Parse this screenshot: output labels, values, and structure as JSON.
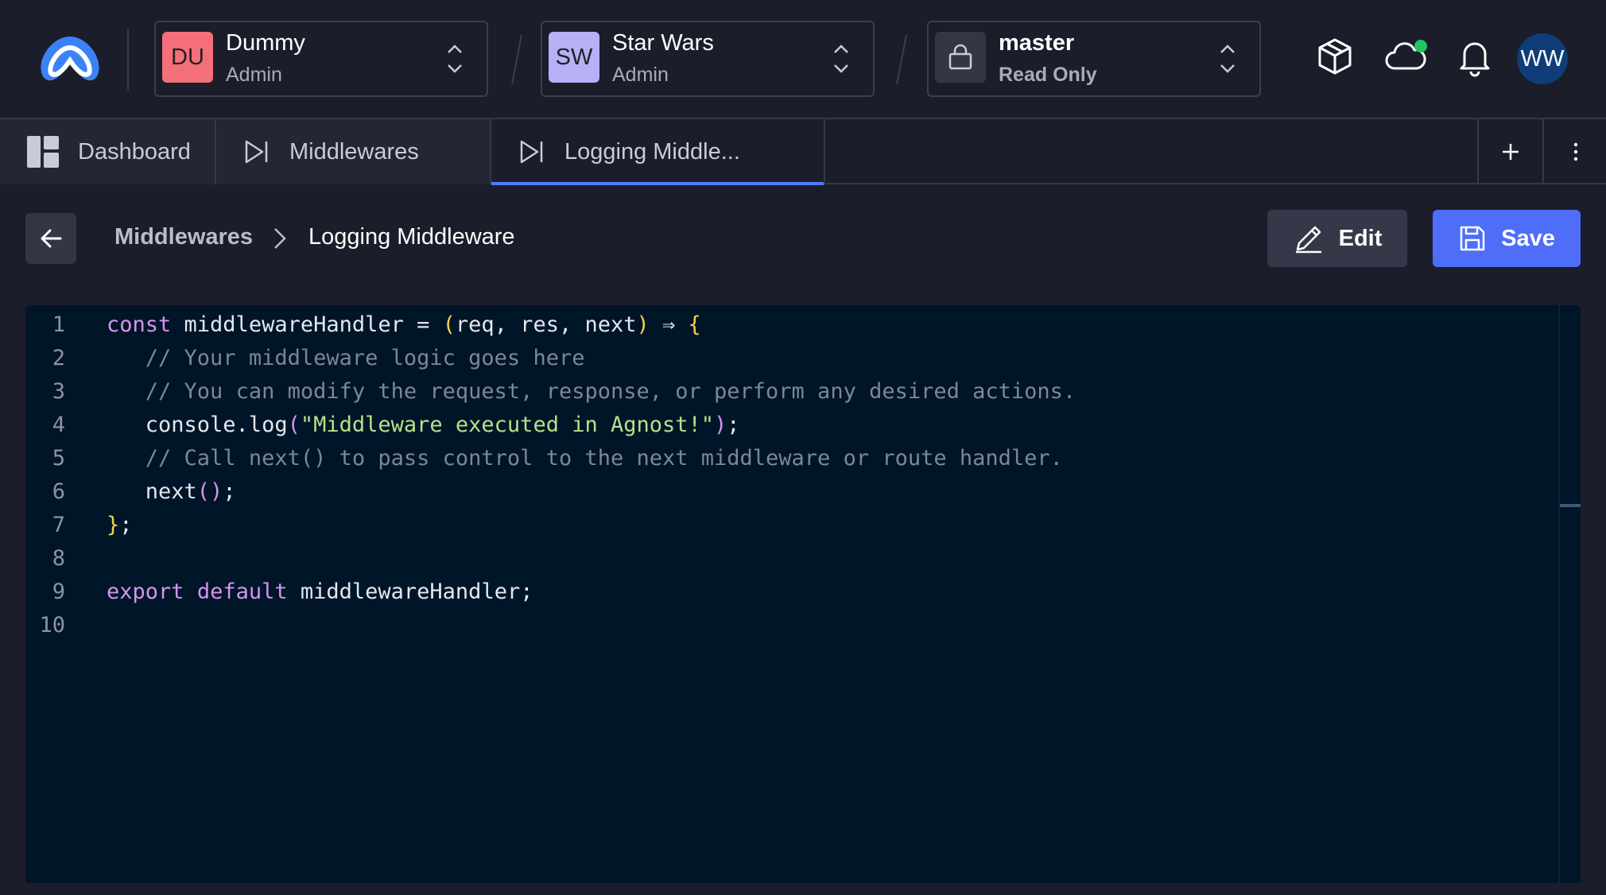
{
  "header": {
    "org": {
      "badge": "DU",
      "badge_color": "#f56f7a",
      "name": "Dummy",
      "role": "Admin"
    },
    "app": {
      "badge": "SW",
      "badge_color": "#b6b1f7",
      "name": "Star Wars",
      "role": "Admin"
    },
    "branch": {
      "name": "master",
      "mode": "Read Only"
    },
    "user_initials": "WW"
  },
  "tabs": [
    {
      "label": "Dashboard",
      "icon": "dashboard-icon",
      "active": false
    },
    {
      "label": "Middlewares",
      "icon": "middleware-icon",
      "active": false
    },
    {
      "label": "Logging Middle...",
      "icon": "middleware-icon",
      "active": true
    }
  ],
  "breadcrumb": {
    "parent": "Middlewares",
    "current": "Logging Middleware"
  },
  "toolbar": {
    "edit_label": "Edit",
    "save_label": "Save"
  },
  "editor": {
    "line_numbers": [
      "1",
      "2",
      "3",
      "4",
      "5",
      "6",
      "7",
      "8",
      "9",
      "10"
    ],
    "lines": [
      [
        [
          "kw",
          "const"
        ],
        [
          "p",
          " middlewareHandler = "
        ],
        [
          "br1",
          "("
        ],
        [
          "p",
          "req, res, next"
        ],
        [
          "br1",
          ")"
        ],
        [
          "p",
          " ⇒ "
        ],
        [
          "br1",
          "{"
        ]
      ],
      [
        [
          "p",
          "   "
        ],
        [
          "cm",
          "// Your middleware logic goes here"
        ]
      ],
      [
        [
          "p",
          "   "
        ],
        [
          "cm",
          "// You can modify the request, response, or perform any desired actions."
        ]
      ],
      [
        [
          "p",
          "   console.log"
        ],
        [
          "br2",
          "("
        ],
        [
          "st",
          "\"Middleware executed in Agnost!\""
        ],
        [
          "br2",
          ")"
        ],
        [
          "p",
          ";"
        ]
      ],
      [
        [
          "p",
          "   "
        ],
        [
          "cm",
          "// Call next() to pass control to the next middleware or route handler."
        ]
      ],
      [
        [
          "p",
          "   next"
        ],
        [
          "br2",
          "()"
        ],
        [
          "p",
          ";"
        ]
      ],
      [
        [
          "br1",
          "}"
        ],
        [
          "p",
          ";"
        ]
      ],
      [],
      [
        [
          "kw",
          "export"
        ],
        [
          "p",
          " "
        ],
        [
          "kw",
          "default"
        ],
        [
          "p",
          " middlewareHandler;"
        ]
      ],
      []
    ]
  }
}
